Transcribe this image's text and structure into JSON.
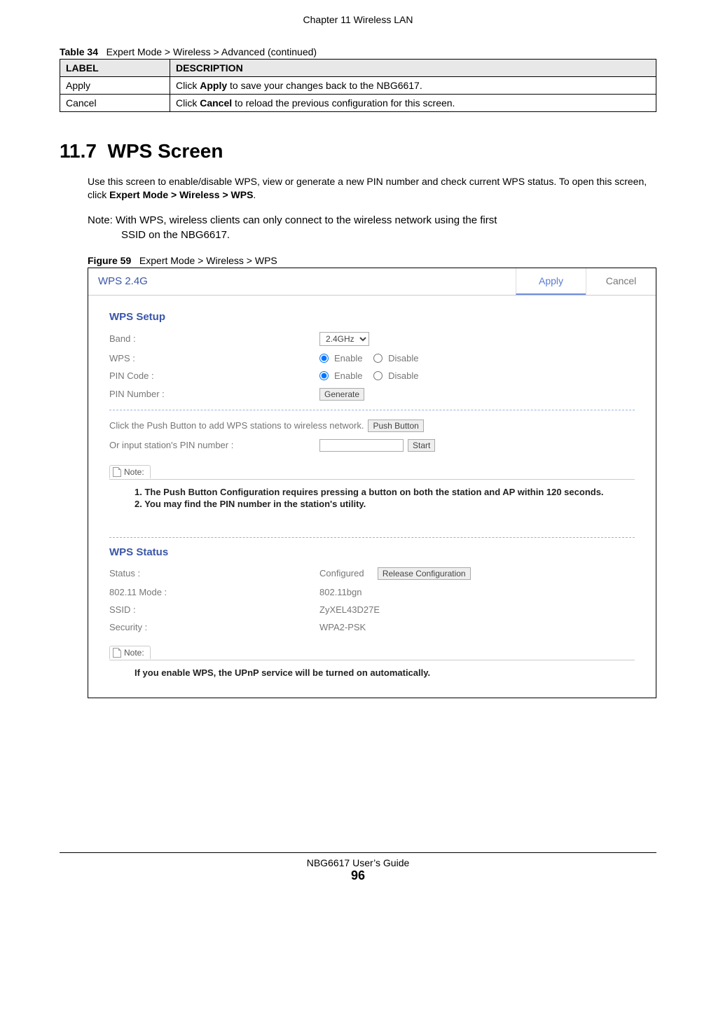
{
  "chapter_header": "Chapter 11 Wireless LAN",
  "table34": {
    "caption_prefix": "Table 34",
    "caption_text": "Expert Mode > Wireless > Advanced (continued)",
    "headers": {
      "label": "LABEL",
      "description": "DESCRIPTION"
    },
    "rows": [
      {
        "label": "Apply",
        "desc_pre": "Click ",
        "desc_bold": "Apply",
        "desc_post": " to save your changes back to the NBG6617."
      },
      {
        "label": "Cancel",
        "desc_pre": "Click ",
        "desc_bold": "Cancel",
        "desc_post": " to reload the previous configuration for this screen."
      }
    ]
  },
  "section": {
    "number": "11.7",
    "title": "WPS Screen",
    "intro_pre": "Use this screen to enable/disable WPS, view or generate a new PIN number and check current WPS status. To open this screen, click ",
    "intro_bold": "Expert Mode > Wireless > WPS",
    "intro_post": ".",
    "note_line1": "Note: With WPS, wireless clients can only connect to the wireless network using the first",
    "note_line2": "SSID on the NBG6617."
  },
  "figure": {
    "caption_prefix": "Figure 59",
    "caption_text": "Expert Mode > Wireless > WPS",
    "titlebar": {
      "title": "WPS 2.4G",
      "apply": "Apply",
      "cancel": "Cancel"
    },
    "setup": {
      "heading": "WPS Setup",
      "band_label": "Band :",
      "band_value": "2.4GHz",
      "wps_label": "WPS :",
      "pin_code_label": "PIN Code :",
      "pin_number_label": "PIN Number :",
      "enable": "Enable",
      "disable": "Disable",
      "generate": "Generate"
    },
    "pbc": {
      "line1": "Click the Push Button to add WPS stations to wireless network.",
      "push_button": "Push Button",
      "line2": "Or input station's PIN number :",
      "start": "Start"
    },
    "note1": {
      "tab": "Note:",
      "l1": "1. The Push Button Configuration requires pressing a button on both the station and AP within 120 seconds.",
      "l2": "2. You may find the PIN number in the station's utility."
    },
    "status": {
      "heading": "WPS Status",
      "status_label": "Status :",
      "status_value": "Configured",
      "release": "Release Configuration",
      "mode_label": "802.11 Mode :",
      "mode_value": "802.11bgn",
      "ssid_label": "SSID :",
      "ssid_value": "ZyXEL43D27E",
      "security_label": "Security :",
      "security_value": "WPA2-PSK"
    },
    "note2": {
      "tab": "Note:",
      "l1": "If you enable WPS, the UPnP service will be turned on automatically."
    }
  },
  "footer": {
    "guide": "NBG6617 User’s Guide",
    "page": "96"
  }
}
